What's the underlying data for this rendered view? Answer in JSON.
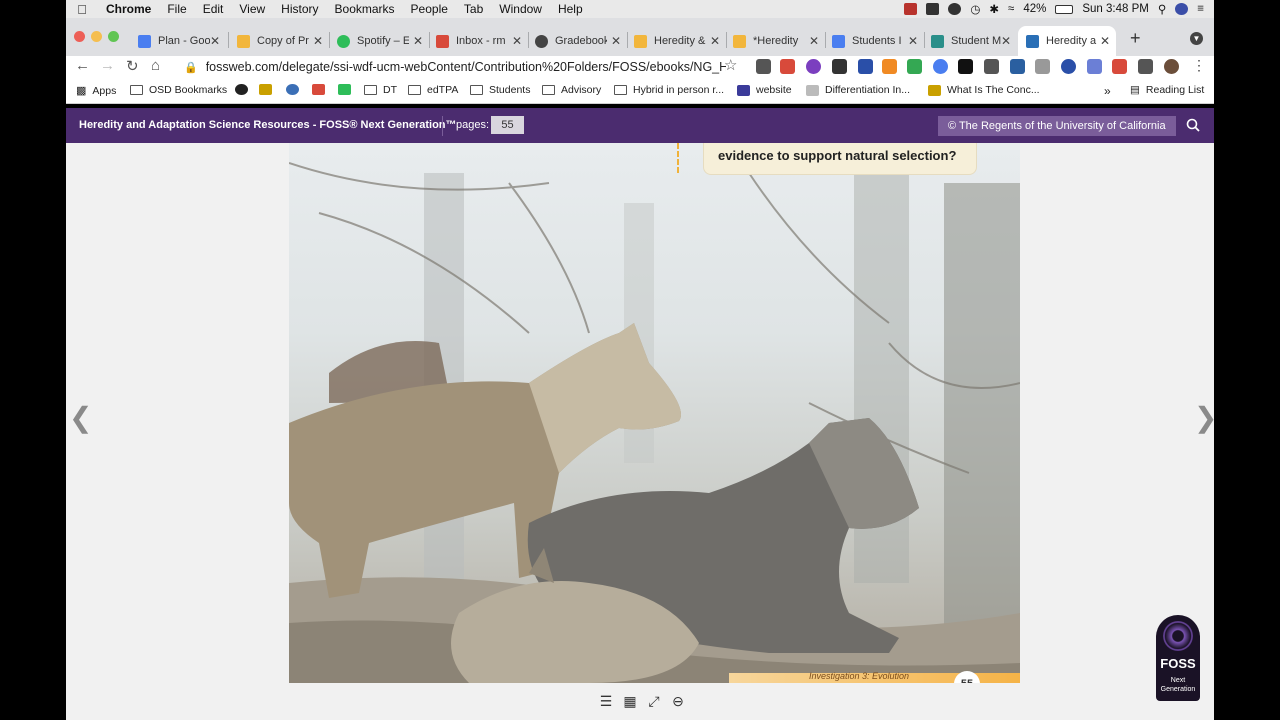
{
  "menubar": {
    "app": "Chrome",
    "items": [
      "File",
      "Edit",
      "View",
      "History",
      "Bookmarks",
      "People",
      "Tab",
      "Window",
      "Help"
    ],
    "battery": "42%",
    "clock": "Sun 3:48 PM"
  },
  "tabs": [
    {
      "label": "Plan - Goo",
      "color": "#4a7ef0"
    },
    {
      "label": "Copy of Pr",
      "color": "#f2b63c"
    },
    {
      "label": "Spotify – E",
      "color": "#2ebd59"
    },
    {
      "label": "Inbox - rm",
      "color": "#d84a3b"
    },
    {
      "label": "Gradebook",
      "color": "#444444"
    },
    {
      "label": "Heredity &",
      "color": "#f2b63c"
    },
    {
      "label": "*Heredity",
      "color": "#f2b63c"
    },
    {
      "label": "Students I",
      "color": "#4a7ef0"
    },
    {
      "label": "Student M",
      "color": "#2a8f8a"
    },
    {
      "label": "Heredity a",
      "color": "#2a6fb6",
      "active": true
    }
  ],
  "toolbar": {
    "url": "fossweb.com/delegate/ssi-wdf-ucm-webContent/Contribution%20Folders/FOSS/ebooks/NG_H..."
  },
  "bookmarks": [
    {
      "label": "Apps",
      "type": "apps"
    },
    {
      "label": "OSD Bookmarks",
      "type": "folder"
    },
    {
      "label": "",
      "type": "icon",
      "color": "#222"
    },
    {
      "label": "",
      "type": "icon",
      "color": "#c9a000"
    },
    {
      "label": "",
      "type": "icon",
      "color": "#3b6fb6"
    },
    {
      "label": "",
      "type": "icon",
      "color": "#d84a3b"
    },
    {
      "label": "",
      "type": "icon",
      "color": "#2ebd59"
    },
    {
      "label": "DT",
      "type": "folder"
    },
    {
      "label": "edTPA",
      "type": "folder"
    },
    {
      "label": "Students",
      "type": "folder"
    },
    {
      "label": "Advisory",
      "type": "folder"
    },
    {
      "label": "Hybrid in person r...",
      "type": "folder"
    },
    {
      "label": "website",
      "type": "icon",
      "color": "#3b3b9a"
    },
    {
      "label": "Differentiation In...",
      "type": "icon",
      "color": "#999"
    },
    {
      "label": "What Is The Conc...",
      "type": "icon",
      "color": "#c9a000"
    },
    {
      "label": "Reading List",
      "type": "reading"
    }
  ],
  "foss": {
    "title": "Heredity and Adaptation Science Resources - FOSS® Next Generation™",
    "pages_label": "pages:",
    "page_number": "55",
    "copyright": "© The Regents of the University of California"
  },
  "ebook": {
    "callout": "evidence to support natural selection?",
    "footer_text": "Investigation 3: Evolution",
    "footer_page": "55"
  },
  "logo": {
    "word": "FOSS",
    "sub1": "Next",
    "sub2": "Generation"
  }
}
